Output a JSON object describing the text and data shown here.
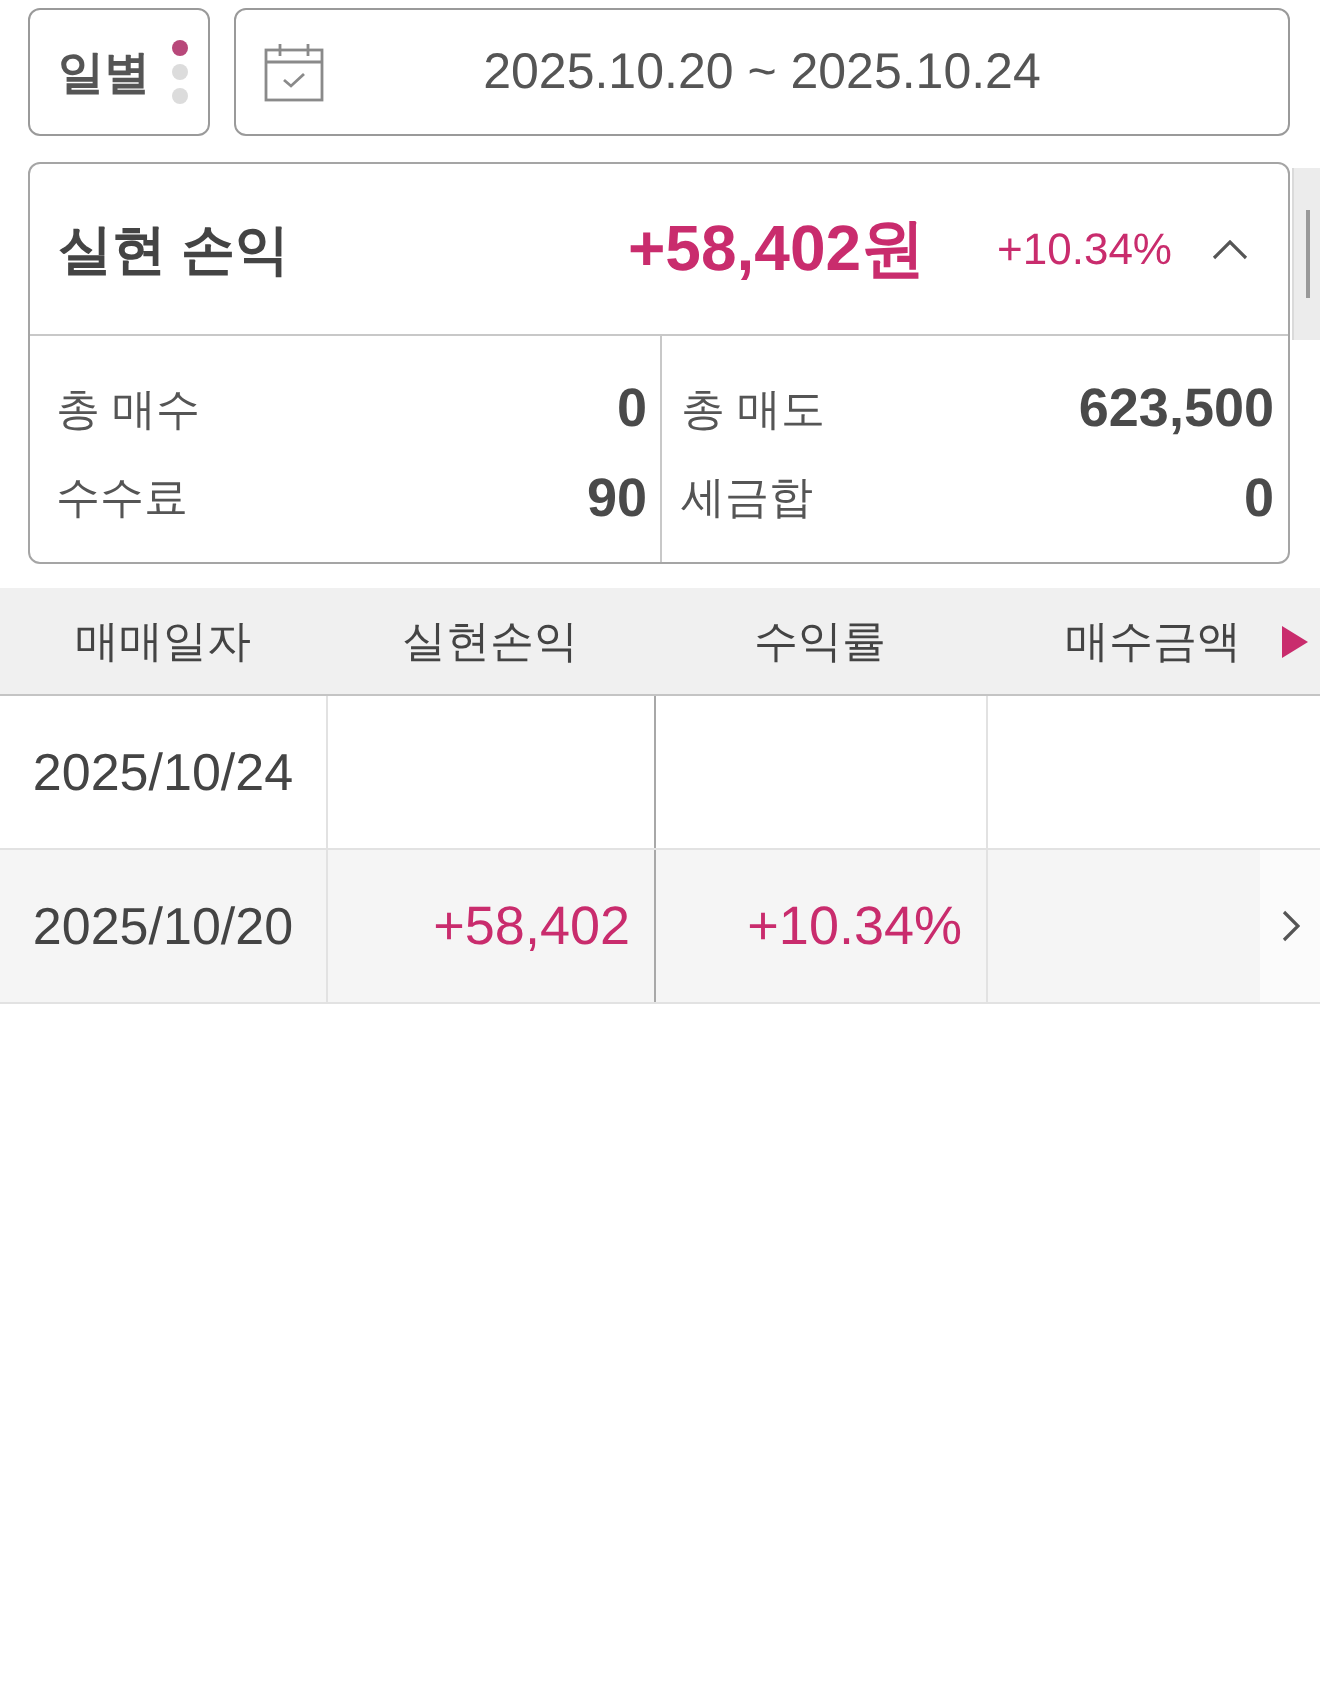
{
  "period_selector": {
    "label": "일별",
    "dots": [
      {
        "selected": true
      },
      {
        "selected": false
      },
      {
        "selected": false
      }
    ]
  },
  "date_range": {
    "value": "2025.10.20 ~ 2025.10.24"
  },
  "summary": {
    "title": "실현 손익",
    "amount": "+58,402원",
    "rate": "+10.34%",
    "expanded": true,
    "details": [
      {
        "label": "총 매수",
        "value": "0"
      },
      {
        "label": "총 매도",
        "value": "623,500"
      },
      {
        "label": "수수료",
        "value": "90"
      },
      {
        "label": "세금합",
        "value": "0"
      }
    ]
  },
  "table": {
    "columns": [
      "매매일자",
      "실현손익",
      "수익률",
      "매수금액"
    ],
    "rows": [
      {
        "trade_date": "2025/10/24",
        "has_detail": false
      },
      {
        "trade_date": "2025/10/20",
        "realized_pnl": "+58,402",
        "return_rate": "+10.34%",
        "has_detail": true
      }
    ]
  }
}
